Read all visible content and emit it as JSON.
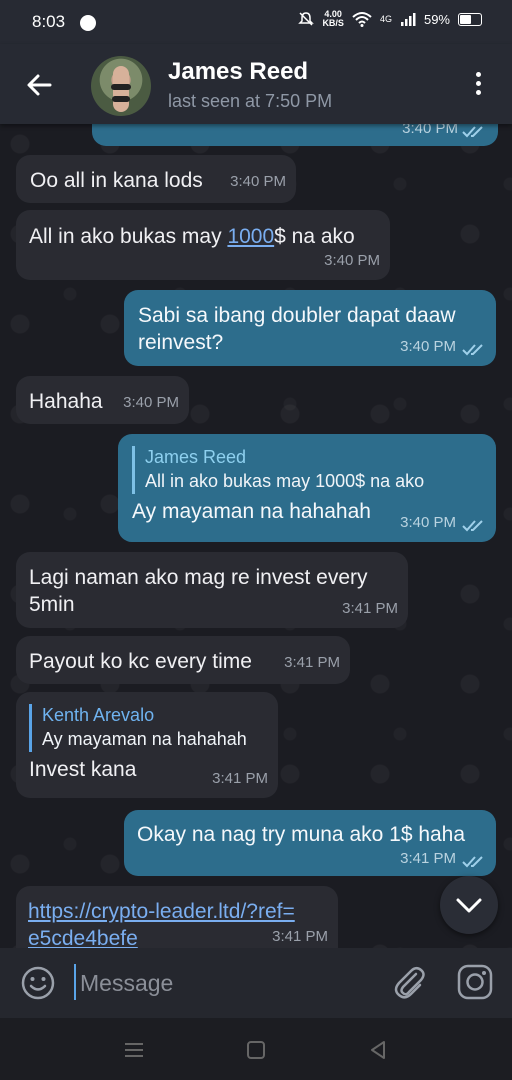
{
  "status_bar": {
    "time": "8:03",
    "speed_value": "4.00",
    "speed_unit": "KB/S",
    "network": "4G",
    "battery": "59%",
    "battery_level": 0.59
  },
  "header": {
    "contact_name": "James Reed",
    "last_seen": "last seen at 7:50 PM"
  },
  "messages": [
    {
      "id": "m0",
      "direction": "out",
      "text": "",
      "time": "3:40 PM",
      "read": true
    },
    {
      "id": "m1",
      "direction": "in",
      "text": "Oo all in kana lods",
      "time": "3:40 PM"
    },
    {
      "id": "m2",
      "direction": "in",
      "text_before": "All in ako bukas may ",
      "link_text": "1000",
      "text_after": "$ na ako",
      "time": "3:40 PM"
    },
    {
      "id": "m3",
      "direction": "out",
      "text": "Sabi sa ibang doubler dapat daaw reinvest?",
      "time": "3:40 PM",
      "read": true
    },
    {
      "id": "m4",
      "direction": "in",
      "text": "Hahaha",
      "time": "3:40 PM"
    },
    {
      "id": "m5",
      "direction": "out",
      "quote_name": "James Reed",
      "quote_text": "All in ako bukas may 1000$ na ako",
      "text": "Ay mayaman na hahahah",
      "time": "3:40 PM",
      "read": true
    },
    {
      "id": "m6",
      "direction": "in",
      "text": "Lagi naman ako mag re invest every 5min",
      "time": "3:41 PM"
    },
    {
      "id": "m7",
      "direction": "in",
      "text": "Payout ko kc every time",
      "time": "3:41 PM"
    },
    {
      "id": "m8",
      "direction": "in",
      "quote_name": "Kenth Arevalo",
      "quote_text": "Ay mayaman na hahahah",
      "text": "Invest kana",
      "time": "3:41 PM"
    },
    {
      "id": "m9",
      "direction": "out",
      "text": "Okay na nag try muna ako 1$ haha",
      "time": "3:41 PM",
      "read": true
    },
    {
      "id": "m10",
      "direction": "in",
      "link": "https://crypto-leader.ltd/?ref=e5cde4befe",
      "link_line1": "https://crypto-leader.ltd/?ref=",
      "link_line2": "e5cde4befe",
      "time": "3:41 PM"
    }
  ],
  "composer": {
    "placeholder": "Message"
  },
  "colors": {
    "incoming_bubble": "#2a2b32",
    "outgoing_bubble": "#2d6d8c",
    "header_bg": "#272a33",
    "link": "#7aaef0",
    "accent": "#5aa4e8"
  },
  "icons": {
    "back": "arrow-left-icon",
    "menu": "more-vertical-icon",
    "emoji": "emoji-icon",
    "attach": "paperclip-icon",
    "camera": "instagram-camera-icon",
    "scroll": "chevron-down-icon"
  }
}
